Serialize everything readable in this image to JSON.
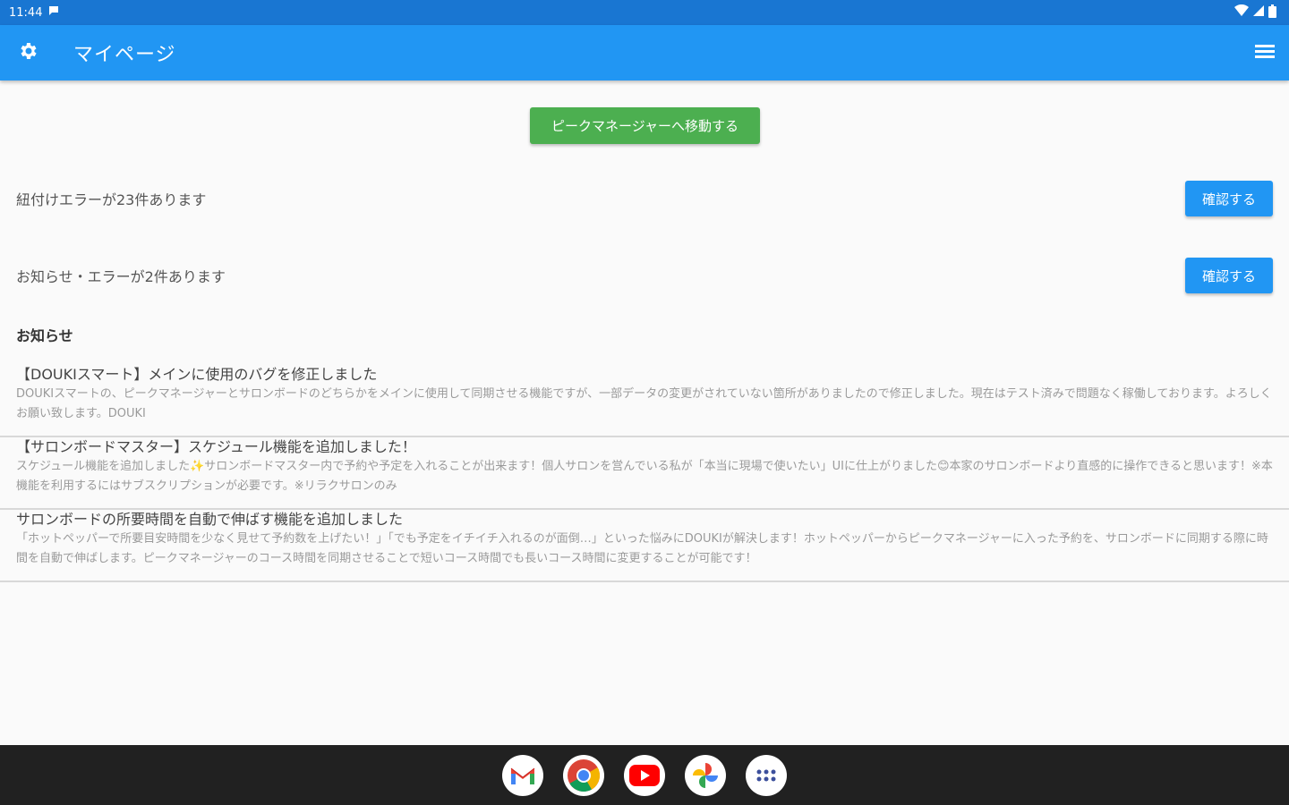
{
  "status_bar": {
    "time": "11:44"
  },
  "app_bar": {
    "title": "マイページ"
  },
  "actions": {
    "move_button": "ピークマネージャーへ移動する",
    "link_error": {
      "label": "紐付けエラーが23件あります",
      "button": "確認する"
    },
    "notice_error": {
      "label": "お知らせ・エラーが2件あります",
      "button": "確認する"
    }
  },
  "news": {
    "heading": "お知らせ",
    "items": [
      {
        "title": "【DOUKIスマート】メインに使用のバグを修正しました",
        "body": "DOUKIスマートの、ピークマネージャーとサロンボードのどちらかをメインに使用して同期させる機能ですが、一部データの変更がされていない箇所がありましたので修正しました。現在はテスト済みで問題なく稼働しております。よろしくお願い致します。DOUKI"
      },
      {
        "title": "【サロンボードマスター】スケジュール機能を追加しました！",
        "body": "スケジュール機能を追加しました✨サロンボードマスター内で予約や予定を入れることが出来ます！個人サロンを営んでいる私が「本当に現場で使いたい」UIに仕上がりました😊本家のサロンボードより直感的に操作できると思います！※本機能を利用するにはサブスクリプションが必要です。※リラクサロンのみ"
      },
      {
        "title": "サロンボードの所要時間を自動で伸ばす機能を追加しました",
        "body": "「ホットペッパーで所要目安時間を少なく見せて予約数を上げたい！」「でも予定をイチイチ入れるのが面倒…」といった悩みにDOUKIが解決します！ホットペッパーからピークマネージャーに入った予約を、サロンボードに同期する際に時間を自動で伸ばします。ピークマネージャーのコース時間を同期させることで短いコース時間でも長いコース時間に変更することが可能です！"
      }
    ]
  },
  "dock": {
    "apps": [
      "gmail-icon",
      "chrome-icon",
      "youtube-icon",
      "photos-icon",
      "app-drawer-icon"
    ]
  }
}
